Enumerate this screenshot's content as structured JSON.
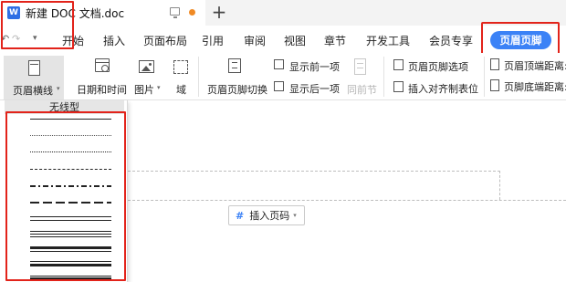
{
  "title_bar": {
    "logo_text": "W",
    "doc_title": "新建 DOC 文档.doc",
    "new_tab": "+"
  },
  "quick_access": {
    "undo": "↶",
    "redo": "↷",
    "more": "▾"
  },
  "menu": {
    "items": [
      "开始",
      "插入",
      "页面布局",
      "引用",
      "审阅",
      "视图",
      "章节",
      "开发工具",
      "会员专享"
    ],
    "active_tab": "页眉页脚"
  },
  "ribbon": {
    "header_rule": "页眉横线",
    "date_time": "日期和时间",
    "picture": "图片",
    "field": "域",
    "switch_header_footer": "页眉页脚切换",
    "show_previous": "显示前一项",
    "show_next": "显示后一项",
    "same_as_previous": "同前节",
    "header_footer_options": "页眉页脚选项",
    "insert_align_tab": "插入对齐制表位",
    "header_top_distance": "页眉顶端距离:",
    "footer_bottom_distance": "页脚底端距离:"
  },
  "dropdown": {
    "no_line": "无线型",
    "line_styles": [
      "single-thin",
      "dotted-fine",
      "dotted",
      "dashed",
      "dash-dot",
      "long-dash",
      "double",
      "triple",
      "thick-thin",
      "thin-thick",
      "thin-thick-thin"
    ]
  },
  "document": {
    "insert_page_number": "插入页码",
    "page_number_icon": "#"
  },
  "colors": {
    "accent_blue": "#3b82f6",
    "highlight_red": "#e2231a",
    "unsaved_dot": "#f08a24"
  }
}
